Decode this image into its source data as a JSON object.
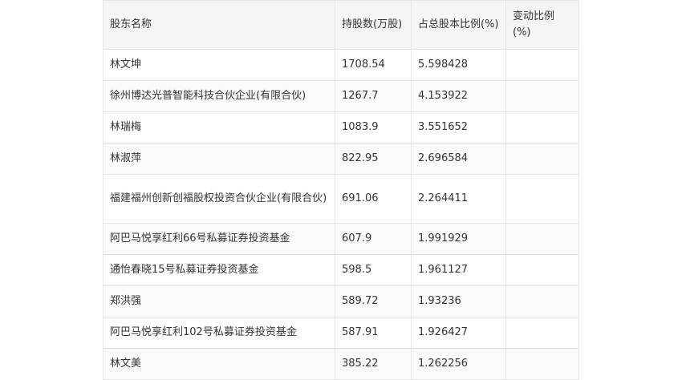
{
  "table": {
    "headers": {
      "name": "股东名称",
      "shares": "持股数(万股)",
      "ratio": "占总股本比例(%)",
      "change": "变动比例(%)"
    },
    "rows": [
      {
        "name": "林文坤",
        "shares": "1708.54",
        "ratio": "5.598428",
        "change": ""
      },
      {
        "name": "徐州博达光普智能科技合伙企业(有限合伙)",
        "shares": "1267.7",
        "ratio": "4.153922",
        "change": ""
      },
      {
        "name": "林瑞梅",
        "shares": "1083.9",
        "ratio": "3.551652",
        "change": ""
      },
      {
        "name": "林淑萍",
        "shares": "822.95",
        "ratio": "2.696584",
        "change": ""
      },
      {
        "name": "福建福州创新创福股权投资合伙企业(有限合伙)",
        "shares": "691.06",
        "ratio": "2.264411",
        "change": ""
      },
      {
        "name": "阿巴马悦享红利66号私募证券投资基金",
        "shares": "607.9",
        "ratio": "1.991929",
        "change": ""
      },
      {
        "name": "通怡春晓15号私募证券投资基金",
        "shares": "598.5",
        "ratio": "1.961127",
        "change": ""
      },
      {
        "name": "郑洪强",
        "shares": "589.72",
        "ratio": "1.93236",
        "change": ""
      },
      {
        "name": "阿巴马悦享红利102号私募证券投资基金",
        "shares": "587.91",
        "ratio": "1.926427",
        "change": ""
      },
      {
        "name": "林文美",
        "shares": "385.22",
        "ratio": "1.262256",
        "change": ""
      }
    ]
  }
}
